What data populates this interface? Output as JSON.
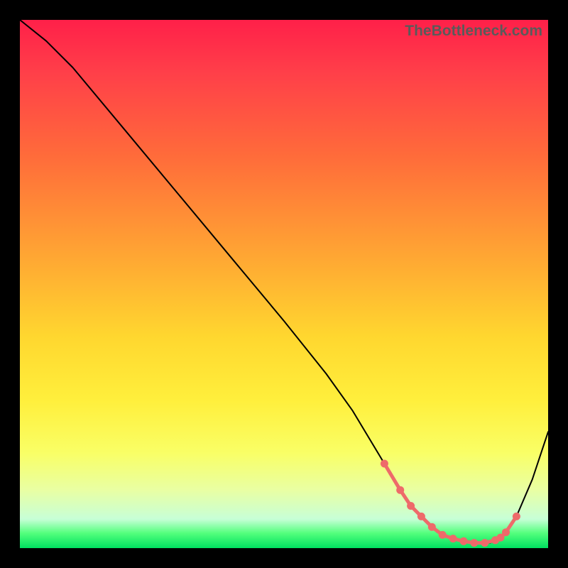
{
  "watermark": "TheBottleneck.com",
  "chart_data": {
    "type": "line",
    "title": "",
    "xlabel": "",
    "ylabel": "",
    "xlim": [
      0,
      100
    ],
    "ylim": [
      0,
      100
    ],
    "grid": false,
    "legend": false,
    "series": [
      {
        "name": "bottleneck-curve",
        "x": [
          0,
          5,
          10,
          20,
          30,
          40,
          50,
          58,
          63,
          69,
          72,
          75,
          79,
          83,
          86,
          89,
          91,
          94,
          97,
          100
        ],
        "y": [
          100,
          96,
          91,
          79,
          67,
          55,
          43,
          33,
          26,
          16,
          11,
          7,
          3,
          1.5,
          1,
          1,
          2,
          6,
          13,
          22
        ]
      }
    ],
    "markers": {
      "note": "visible salmon dots along the valley region",
      "x": [
        69,
        72,
        74,
        76,
        78,
        80,
        82,
        84,
        86,
        88,
        90,
        91,
        92,
        94
      ],
      "y": [
        16,
        11,
        8,
        6,
        4,
        2.5,
        1.8,
        1.3,
        1,
        1,
        1.5,
        2,
        3,
        6
      ]
    }
  }
}
